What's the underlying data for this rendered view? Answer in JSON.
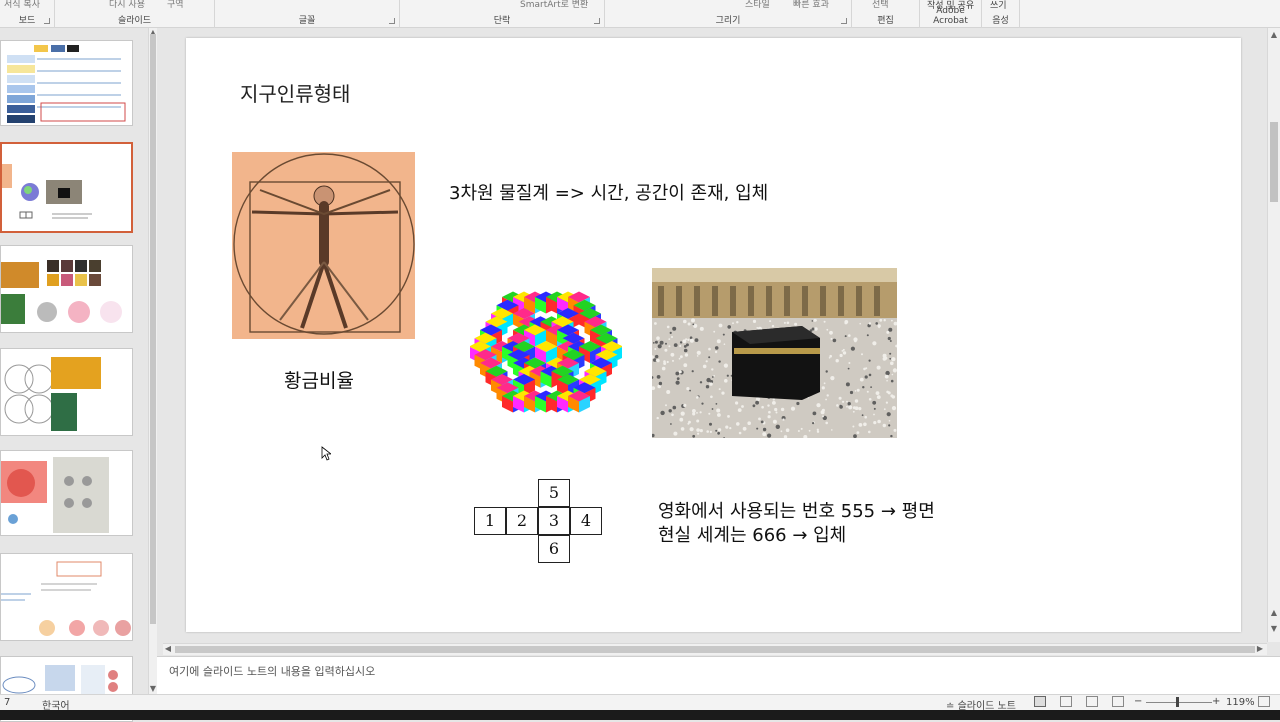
{
  "ribbon": {
    "groups": [
      {
        "label": "보드"
      },
      {
        "label": "슬라이드"
      },
      {
        "label": "글꼴"
      },
      {
        "label": "단락"
      },
      {
        "label": "그리기"
      },
      {
        "label": "편집"
      },
      {
        "label": "Adobe Acrobat"
      },
      {
        "label": "음성"
      }
    ],
    "top_texts": {
      "format": "서식 복사",
      "reuse": "다시 사용",
      "section": "구역",
      "smartart": "SmartArt로 변환",
      "style": "스타일",
      "quick": "빠른 효과",
      "select": "선택",
      "create_share": "작성 및 공유",
      "dictate": "쓰기"
    }
  },
  "slide": {
    "title": "지구인류형태",
    "caption_golden": "황금비율",
    "caption_3d": "3차원 물질계 => 시간, 공간이 존재, 입체",
    "caption_movie": "영화에서 사용되는 번호 555 → 평면",
    "caption_real": "현실 세계는 666 → 입체",
    "net_cells": [
      "5",
      "1",
      "2",
      "3",
      "4",
      "6"
    ]
  },
  "notes": {
    "placeholder": "여기에 슬라이드 노트의 내용을 입력하십시오"
  },
  "status": {
    "language": "한국어",
    "notes_button": "슬라이드 노트",
    "zoom": "119%"
  },
  "colors": {
    "accent": "#d2603a",
    "vitruvian_bg": "#f2b58c"
  }
}
